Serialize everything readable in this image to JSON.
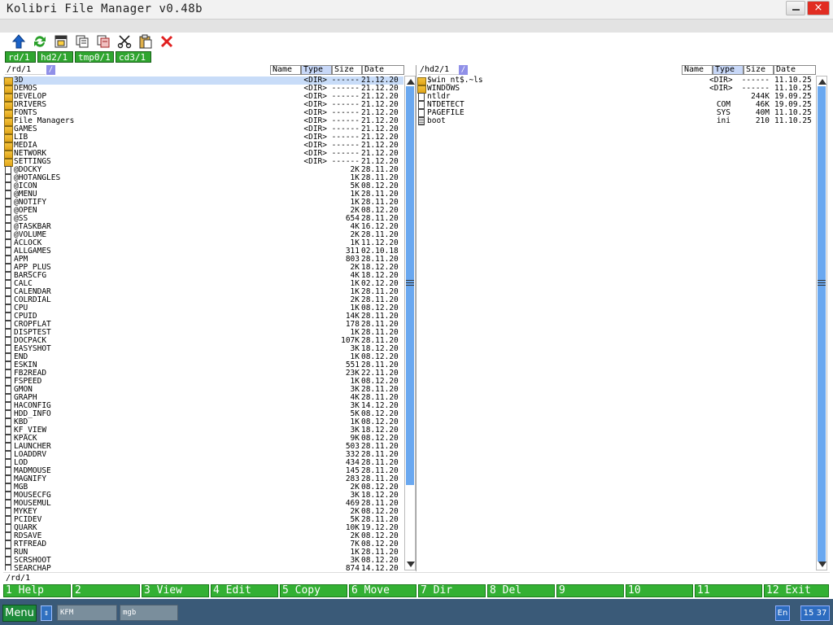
{
  "window": {
    "title": "Kolibri File Manager v0.48b",
    "close_label": "×"
  },
  "toolbar_icons": [
    "up-arrow-icon",
    "refresh-icon",
    "copy-name-icon",
    "copy-icon",
    "copy-path-icon",
    "cut-icon",
    "paste-icon",
    "delete-icon"
  ],
  "drives": [
    "rd/1",
    "hd2/1",
    "tmp0/1",
    "cd3/1"
  ],
  "left": {
    "path": "/rd/1",
    "slash": "/",
    "columns": {
      "name": "Name",
      "type": "Type",
      "size": "Size",
      "date": "Date"
    },
    "rows": [
      {
        "n": "3D",
        "t": "<DIR>",
        "s": "------",
        "d": "21.12.20",
        "k": "d"
      },
      {
        "n": "DEMOS",
        "t": "<DIR>",
        "s": "------",
        "d": "21.12.20",
        "k": "d"
      },
      {
        "n": "DEVELOP",
        "t": "<DIR>",
        "s": "------",
        "d": "21.12.20",
        "k": "d"
      },
      {
        "n": "DRIVERS",
        "t": "<DIR>",
        "s": "------",
        "d": "21.12.20",
        "k": "d"
      },
      {
        "n": "FONTS",
        "t": "<DIR>",
        "s": "------",
        "d": "21.12.20",
        "k": "d"
      },
      {
        "n": "File Managers",
        "t": "<DIR>",
        "s": "------",
        "d": "21.12.20",
        "k": "d"
      },
      {
        "n": "GAMES",
        "t": "<DIR>",
        "s": "------",
        "d": "21.12.20",
        "k": "d"
      },
      {
        "n": "LIB",
        "t": "<DIR>",
        "s": "------",
        "d": "21.12.20",
        "k": "d"
      },
      {
        "n": "MEDIA",
        "t": "<DIR>",
        "s": "------",
        "d": "21.12.20",
        "k": "d"
      },
      {
        "n": "NETWORK",
        "t": "<DIR>",
        "s": "------",
        "d": "21.12.20",
        "k": "d"
      },
      {
        "n": "SETTINGS",
        "t": "<DIR>",
        "s": "------",
        "d": "21.12.20",
        "k": "d"
      },
      {
        "n": "@DOCKY",
        "t": "",
        "s": "2K",
        "d": "28.11.20",
        "k": "f"
      },
      {
        "n": "@HOTANGLES",
        "t": "",
        "s": "1K",
        "d": "28.11.20",
        "k": "f"
      },
      {
        "n": "@ICON",
        "t": "",
        "s": "5K",
        "d": "08.12.20",
        "k": "f"
      },
      {
        "n": "@MENU",
        "t": "",
        "s": "1K",
        "d": "28.11.20",
        "k": "f"
      },
      {
        "n": "@NOTIFY",
        "t": "",
        "s": "1K",
        "d": "28.11.20",
        "k": "f"
      },
      {
        "n": "@OPEN",
        "t": "",
        "s": "2K",
        "d": "08.12.20",
        "k": "f"
      },
      {
        "n": "@SS",
        "t": "",
        "s": "654",
        "d": "28.11.20",
        "k": "f"
      },
      {
        "n": "@TASKBAR",
        "t": "",
        "s": "4K",
        "d": "16.12.20",
        "k": "f"
      },
      {
        "n": "@VOLUME",
        "t": "",
        "s": "2K",
        "d": "28.11.20",
        "k": "f"
      },
      {
        "n": "ACLOCK",
        "t": "",
        "s": "1K",
        "d": "11.12.20",
        "k": "f"
      },
      {
        "n": "ALLGAMES",
        "t": "",
        "s": "311",
        "d": "02.10.18",
        "k": "f"
      },
      {
        "n": "APM",
        "t": "",
        "s": "803",
        "d": "28.11.20",
        "k": "f"
      },
      {
        "n": "APP_PLUS",
        "t": "",
        "s": "2K",
        "d": "18.12.20",
        "k": "f"
      },
      {
        "n": "BARSCFG",
        "t": "",
        "s": "4K",
        "d": "18.12.20",
        "k": "f"
      },
      {
        "n": "CALC",
        "t": "",
        "s": "1K",
        "d": "02.12.20",
        "k": "f"
      },
      {
        "n": "CALENDAR",
        "t": "",
        "s": "1K",
        "d": "28.11.20",
        "k": "f"
      },
      {
        "n": "COLRDIAL",
        "t": "",
        "s": "2K",
        "d": "28.11.20",
        "k": "f"
      },
      {
        "n": "CPU",
        "t": "",
        "s": "1K",
        "d": "08.12.20",
        "k": "f"
      },
      {
        "n": "CPUID",
        "t": "",
        "s": "14K",
        "d": "28.11.20",
        "k": "f"
      },
      {
        "n": "CROPFLAT",
        "t": "",
        "s": "178",
        "d": "28.11.20",
        "k": "f"
      },
      {
        "n": "DISPTEST",
        "t": "",
        "s": "1K",
        "d": "28.11.20",
        "k": "f"
      },
      {
        "n": "DOCPACK",
        "t": "",
        "s": "107K",
        "d": "28.11.20",
        "k": "f"
      },
      {
        "n": "EASYSHOT",
        "t": "",
        "s": "3K",
        "d": "18.12.20",
        "k": "f"
      },
      {
        "n": "END",
        "t": "",
        "s": "1K",
        "d": "08.12.20",
        "k": "f"
      },
      {
        "n": "ESKIN",
        "t": "",
        "s": "551",
        "d": "28.11.20",
        "k": "f"
      },
      {
        "n": "FB2READ",
        "t": "",
        "s": "23K",
        "d": "22.11.20",
        "k": "f"
      },
      {
        "n": "FSPEED",
        "t": "",
        "s": "1K",
        "d": "08.12.20",
        "k": "f"
      },
      {
        "n": "GMON",
        "t": "",
        "s": "3K",
        "d": "28.11.20",
        "k": "f"
      },
      {
        "n": "GRAPH",
        "t": "",
        "s": "4K",
        "d": "28.11.20",
        "k": "f"
      },
      {
        "n": "HACONFIG",
        "t": "",
        "s": "3K",
        "d": "14.12.20",
        "k": "f"
      },
      {
        "n": "HDD_INFO",
        "t": "",
        "s": "5K",
        "d": "08.12.20",
        "k": "f"
      },
      {
        "n": "KBD",
        "t": "",
        "s": "1K",
        "d": "08.12.20",
        "k": "f"
      },
      {
        "n": "KF_VIEW",
        "t": "",
        "s": "3K",
        "d": "18.12.20",
        "k": "f"
      },
      {
        "n": "KPACK",
        "t": "",
        "s": "9K",
        "d": "08.12.20",
        "k": "f"
      },
      {
        "n": "LAUNCHER",
        "t": "",
        "s": "503",
        "d": "28.11.20",
        "k": "f"
      },
      {
        "n": "LOADDRV",
        "t": "",
        "s": "332",
        "d": "28.11.20",
        "k": "f"
      },
      {
        "n": "LOD",
        "t": "",
        "s": "434",
        "d": "28.11.20",
        "k": "f"
      },
      {
        "n": "MADMOUSE",
        "t": "",
        "s": "145",
        "d": "28.11.20",
        "k": "f"
      },
      {
        "n": "MAGNIFY",
        "t": "",
        "s": "283",
        "d": "28.11.20",
        "k": "f"
      },
      {
        "n": "MGB",
        "t": "",
        "s": "2K",
        "d": "08.12.20",
        "k": "f"
      },
      {
        "n": "MOUSECFG",
        "t": "",
        "s": "3K",
        "d": "18.12.20",
        "k": "f"
      },
      {
        "n": "MOUSEMUL",
        "t": "",
        "s": "469",
        "d": "28.11.20",
        "k": "f"
      },
      {
        "n": "MYKEY",
        "t": "",
        "s": "2K",
        "d": "08.12.20",
        "k": "f"
      },
      {
        "n": "PCIDEV",
        "t": "",
        "s": "5K",
        "d": "28.11.20",
        "k": "f"
      },
      {
        "n": "QUARK",
        "t": "",
        "s": "10K",
        "d": "19.12.20",
        "k": "f"
      },
      {
        "n": "RDSAVE",
        "t": "",
        "s": "2K",
        "d": "08.12.20",
        "k": "f"
      },
      {
        "n": "RTFREAD",
        "t": "",
        "s": "7K",
        "d": "08.12.20",
        "k": "f"
      },
      {
        "n": "RUN",
        "t": "",
        "s": "1K",
        "d": "28.11.20",
        "k": "f"
      },
      {
        "n": "SCRSHOOT",
        "t": "",
        "s": "3K",
        "d": "08.12.20",
        "k": "f"
      },
      {
        "n": "SEARCHAP",
        "t": "",
        "s": "874",
        "d": "14.12.20",
        "k": "f"
      }
    ]
  },
  "right": {
    "path": "/hd2/1",
    "slash": "/",
    "columns": {
      "name": "Name",
      "type": "Type",
      "size": "Size",
      "date": "Date"
    },
    "rows": [
      {
        "n": "$win_nt$.~ls",
        "t": "<DIR>",
        "s": "------",
        "d": "11.10.25",
        "k": "d"
      },
      {
        "n": "WINDOWS",
        "t": "<DIR>",
        "s": "------",
        "d": "11.10.25",
        "k": "d"
      },
      {
        "n": "ntldr",
        "t": "",
        "s": "244K",
        "d": "19.09.25",
        "k": "f"
      },
      {
        "n": "NTDETECT",
        "t": "COM",
        "s": "46K",
        "d": "19.09.25",
        "k": "f"
      },
      {
        "n": "PAGEFILE",
        "t": "SYS",
        "s": "40M",
        "d": "11.10.25",
        "k": "f"
      },
      {
        "n": "boot",
        "t": "ini",
        "s": "210",
        "d": "11.10.25",
        "k": "s"
      }
    ]
  },
  "command_line": "/rd/1",
  "fkeys": [
    {
      "num": "1",
      "label": "Help"
    },
    {
      "num": "2",
      "label": ""
    },
    {
      "num": "3",
      "label": "View"
    },
    {
      "num": "4",
      "label": "Edit"
    },
    {
      "num": "5",
      "label": "Copy"
    },
    {
      "num": "6",
      "label": "Move"
    },
    {
      "num": "7",
      "label": "Dir"
    },
    {
      "num": "8",
      "label": "Del"
    },
    {
      "num": "9",
      "label": ""
    },
    {
      "num": "10",
      "label": ""
    },
    {
      "num": "11",
      "label": ""
    },
    {
      "num": "12",
      "label": "Exit"
    }
  ],
  "taskbar": {
    "menu_label": "Menu",
    "switch_label": "⇕",
    "tasks": [
      "KFM",
      "mgb"
    ],
    "language": "En",
    "clock": "15 37"
  }
}
